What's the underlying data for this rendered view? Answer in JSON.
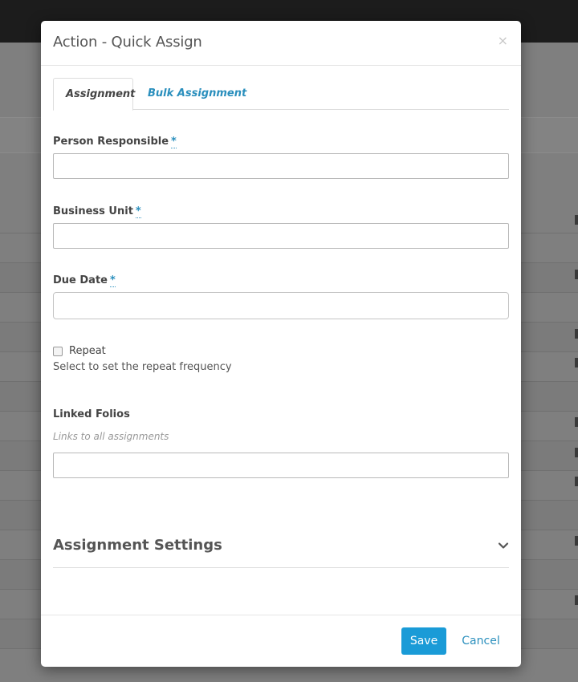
{
  "modal": {
    "title": "Action - Quick Assign",
    "close_symbol": "×"
  },
  "tabs": [
    {
      "label": "Assignment",
      "active": true
    },
    {
      "label": "Bulk Assignment",
      "active": false
    }
  ],
  "form": {
    "required_marker": "*",
    "person_responsible": {
      "label": "Person Responsible",
      "value": ""
    },
    "business_unit": {
      "label": "Business Unit",
      "value": ""
    },
    "due_date": {
      "label": "Due Date",
      "value": ""
    },
    "repeat": {
      "label": "Repeat",
      "checked": false,
      "help": "Select to set the repeat frequency"
    },
    "linked_folios": {
      "label": "Linked Folios",
      "hint": "Links to all assignments",
      "value": ""
    }
  },
  "section": {
    "title": "Assignment Settings",
    "icon": "chevron-down-icon"
  },
  "footer": {
    "save_label": "Save",
    "cancel_label": "Cancel"
  },
  "colors": {
    "accent": "#1a9bd7",
    "link": "#2a8fbd",
    "topbar": "#1c1c1c"
  }
}
